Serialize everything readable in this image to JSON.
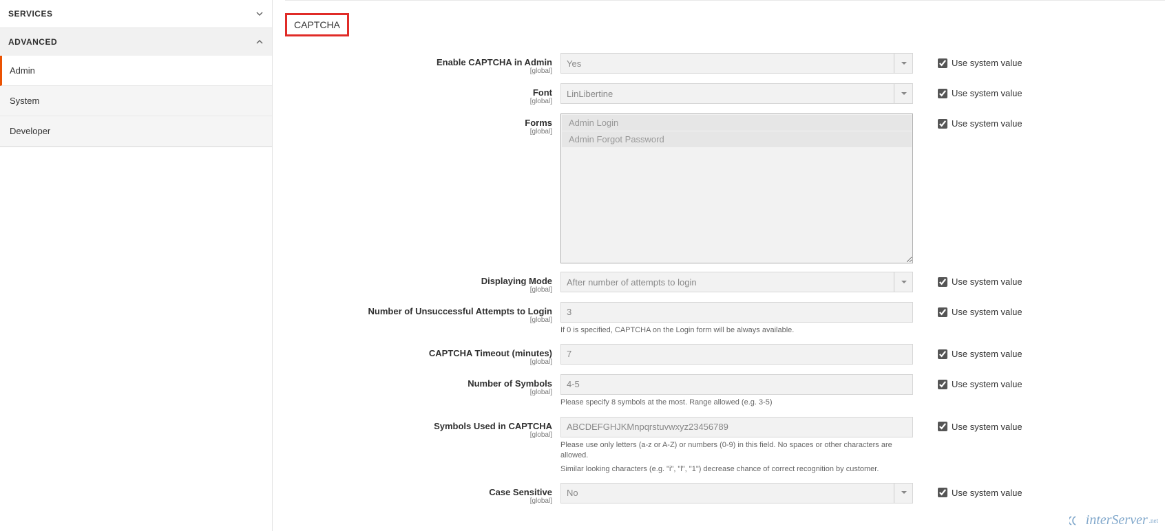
{
  "sidebar": {
    "services": {
      "label": "SERVICES"
    },
    "advanced": {
      "label": "ADVANCED",
      "items": [
        {
          "label": "Admin",
          "active": true
        },
        {
          "label": "System",
          "active": false
        },
        {
          "label": "Developer",
          "active": false
        }
      ]
    }
  },
  "section": {
    "title": "CAPTCHA"
  },
  "common": {
    "use_system_value": "Use system value",
    "scope_global": "[global]"
  },
  "fields": {
    "enable": {
      "label": "Enable CAPTCHA in Admin",
      "value": "Yes"
    },
    "font": {
      "label": "Font",
      "value": "LinLibertine"
    },
    "forms": {
      "label": "Forms",
      "options": [
        "Admin Login",
        "Admin Forgot Password"
      ]
    },
    "display_mode": {
      "label": "Displaying Mode",
      "value": "After number of attempts to login"
    },
    "attempts": {
      "label": "Number of Unsuccessful Attempts to Login",
      "value": "3",
      "help": "If 0 is specified, CAPTCHA on the Login form will be always available."
    },
    "timeout": {
      "label": "CAPTCHA Timeout (minutes)",
      "value": "7"
    },
    "symbols": {
      "label": "Number of Symbols",
      "value": "4-5",
      "help": "Please specify 8 symbols at the most. Range allowed (e.g. 3-5)"
    },
    "symbols_used": {
      "label": "Symbols Used in CAPTCHA",
      "value": "ABCDEFGHJKMnpqrstuvwxyz23456789",
      "help1": "Please use only letters (a-z or A-Z) or numbers (0-9) in this field. No spaces or other characters are allowed.",
      "help2": "Similar looking characters (e.g. \"i\", \"l\", \"1\") decrease chance of correct recognition by customer."
    },
    "case_sensitive": {
      "label": "Case Sensitive",
      "value": "No"
    }
  },
  "watermark": {
    "brand": "interServer",
    "tld": ".net"
  }
}
